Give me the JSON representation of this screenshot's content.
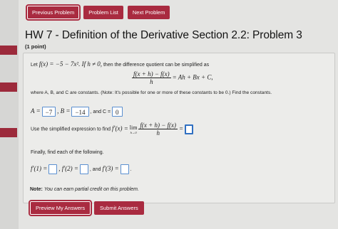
{
  "nav": {
    "previous": "Previous Problem",
    "list": "Problem List",
    "next": "Next Problem"
  },
  "header": {
    "title": "HW 7 - Definition of the Derivative Section 2.2: Problem 3",
    "points": "(1 point)"
  },
  "problem": {
    "intro_prefix": "Let",
    "function": "f(x) = −5 − 7x². If h ≠ 0,",
    "intro_suffix": "then the difference quotient can be simplified as",
    "dq_num": "f(x + h) − f(x)",
    "dq_den": "h",
    "dq_rhs": "= Ah + Bx + C,",
    "constants_text": "where A, B, and C are constants. (Note: It's possible for one or more of these constants to be 0.) Find the constants.",
    "a_label": "A =",
    "a_value": "−7",
    "b_label": ", B =",
    "b_value": "−14",
    "c_label": ", and C =",
    "c_value": "0",
    "use_text": "Use the simplified expression to find",
    "fprime_eq": "f′(x) =",
    "lim": "lim",
    "lim_sub": "h→0",
    "lim_num": "f(x + h) − f(x)",
    "lim_den": "h",
    "lim_eq": "=",
    "finally_text": "Finally, find each of the following.",
    "f1_label": "f′(1) =",
    "f2_label": ", f′(2) =",
    "f3_prefix": ", and",
    "f3_label": "f′(3) =",
    "period": "."
  },
  "note": {
    "label": "Note:",
    "text": "You can earn partial credit on this problem."
  },
  "buttons": {
    "preview": "Preview My Answers",
    "submit": "Submit Answers"
  },
  "colors": {
    "accent": "#a92b40",
    "input_border": "#5a8fd0"
  }
}
